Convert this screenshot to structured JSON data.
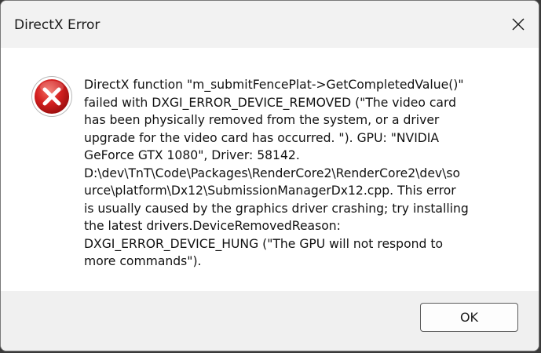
{
  "window": {
    "title": "DirectX Error"
  },
  "dialog": {
    "icon": "error-x-icon",
    "message": "DirectX function \"m_submitFencePlat->GetCompletedValue()\"\nfailed with DXGI_ERROR_DEVICE_REMOVED (\"The video card\nhas been physically removed from the system, or a driver\nupgrade for the video card has occurred. \"). GPU: \"NVIDIA\nGeForce GTX 1080\", Driver: 58142.\nD:\\dev\\TnT\\Code\\Packages\\RenderCore2\\RenderCore2\\dev\\so\nurce\\platform\\Dx12\\SubmissionManagerDx12.cpp. This error\nis usually caused by the graphics driver crashing; try installing\nthe latest drivers.DeviceRemovedReason:\nDXGI_ERROR_DEVICE_HUNG (\"The GPU will not respond to\nmore commands\")."
  },
  "buttons": {
    "ok_label": "OK"
  },
  "colors": {
    "error_red": "#d42020",
    "titlebar_bg": "#f2f2f2",
    "footer_bg": "#f0f0f0"
  }
}
